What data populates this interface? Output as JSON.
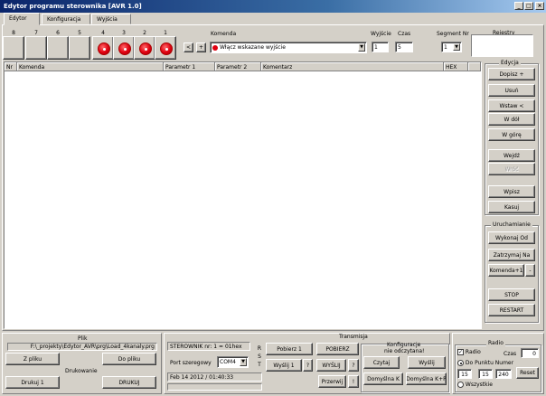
{
  "window": {
    "title": "Edytor programu sterownika [AVR 1.0]",
    "controls": {
      "minimize": "_",
      "maximize": "□",
      "close": "×"
    }
  },
  "tabs": [
    {
      "label": "Edytor"
    },
    {
      "label": "Konfiguracja"
    },
    {
      "label": "Wyjścia"
    }
  ],
  "bits": {
    "numbers": [
      "8",
      "7",
      "6",
      "5",
      "4",
      "3",
      "2",
      "1"
    ],
    "led_color": "#e00010"
  },
  "command_bar": {
    "nav_prev": "<",
    "nav_next": "+",
    "command_label": "Komenda",
    "command_value": "Włącz wskazane wyjście",
    "output_label": "Wyjście",
    "output_value": "1",
    "time_label": "Czas",
    "time_value": "5",
    "segment_label": "Segment Nr",
    "segment_value": "1",
    "registers_label": "Rejestry"
  },
  "table": {
    "columns": [
      "Nr",
      "Komenda",
      "Parametr 1",
      "Parametr 2",
      "Komentarz",
      "HEX"
    ]
  },
  "edit_group": {
    "title": "Edycja",
    "buttons": [
      {
        "label": "Dopisz  +",
        "enabled": true
      },
      {
        "label": "Usuń",
        "enabled": true
      },
      {
        "label": "Wstaw  <",
        "enabled": true
      },
      {
        "label": "W dół",
        "enabled": true
      },
      {
        "label": "W górę",
        "enabled": true
      },
      {
        "label": "Wejdź",
        "enabled": true
      },
      {
        "label": "Wróć",
        "enabled": false
      },
      {
        "label": "Wpisz",
        "enabled": true
      },
      {
        "label": "Kasuj",
        "enabled": true
      }
    ]
  },
  "run_group": {
    "title": "Uruchamianie",
    "run_from": "Wykonaj Od",
    "stop_at": "Zatrzymaj Na",
    "command_plus": "Komenda+1",
    "minus": "-",
    "stop": "STOP",
    "restart": "RESTART"
  },
  "file_group": {
    "title": "Plik",
    "path": "F:\\_projekty\\Edytor_AVR\\prg\\Load_4kanaly.prg",
    "from_file": "Z pliku",
    "to_file": "Do pliku",
    "print_title": "Drukowanie",
    "print1": "Drukuj 1",
    "print_all": "DRUKUJ"
  },
  "transmission": {
    "title": "Transmisja",
    "device_info": "STEROWNIK nr: 1 = 01hex",
    "port_label": "Port szeregowy",
    "port_value": "COM4",
    "rst": [
      "R",
      "S",
      "T"
    ],
    "datetime": "Feb 14 2012 / 01:40:33",
    "fetch1": "Pobierz 1",
    "fetch_all": "POBIERZ",
    "send1": "Wyślij 1",
    "q1": "?",
    "send_all": "WYŚLIJ",
    "q2": "?",
    "interrupt": "Przerwij",
    "excl": "!",
    "config_title": "Konfiguracje",
    "config_status": "nie odczytana!",
    "read": "Czytaj",
    "send": "Wyślij",
    "default_k": "Domyślna K",
    "default_kp": "Domyślna K+P"
  },
  "radio_group": {
    "title": "Radio",
    "radio_label": "Radio",
    "radio_checked": true,
    "time_label": "Czas",
    "time_value": "0",
    "to_point_label": "Do Punktu Numer",
    "v1": "15",
    "v2": "15",
    "v3": "240",
    "reset": "Reset",
    "all_label": "Wszystkie"
  }
}
